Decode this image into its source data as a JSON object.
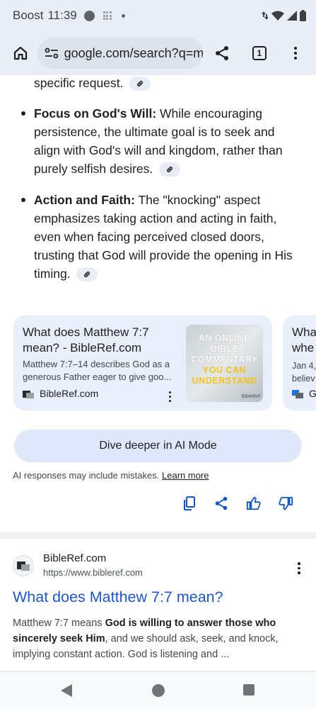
{
  "status_bar": {
    "carrier": "Boost",
    "time": "11:39",
    "icons": [
      "record-dot-icon",
      "grid-notification-icon",
      "dot-icon",
      "data-arrows-icon",
      "wifi-icon",
      "signal-icon",
      "battery-icon"
    ]
  },
  "browser": {
    "url": "google.com/search?q=m",
    "tab_count": "1",
    "icons": [
      "home-icon",
      "site-settings-icon",
      "share-icon",
      "tabs-icon",
      "more-vert-icon"
    ]
  },
  "ai_overview": {
    "lead_fragment": "specific request.",
    "bullets": [
      {
        "heading": "Focus on God's Will:",
        "text": " While encouraging persistence, the ultimate goal is to seek and align with God's will and kingdom, rather than purely selfish desires."
      },
      {
        "heading": "Action and Faith:",
        "text": " The \"knocking\" aspect emphasizes taking action and acting in faith, even when facing perceived closed doors, trusting that God will provide the opening in His timing."
      }
    ],
    "source_cards": [
      {
        "title": "What does Matthew 7:7 mean? - BibleRef.com",
        "snippet": "Matthew 7:7–14 describes God as a generous Father eager to give goo...",
        "source": "BibleRef.com",
        "thumb_line1": "AN ONLINE BIBLE COMMENTARY",
        "thumb_line2": "YOU CAN UNDERSTAND",
        "thumb_brand": "BibleRef"
      },
      {
        "title_partial": "Wha whe",
        "snippet_partial": "Jan 4, believ",
        "source_partial": "G"
      }
    ],
    "dive_button": "Dive deeper in AI Mode",
    "disclaimer": "AI responses may include mistakes.",
    "learn_more": "Learn more",
    "action_icons": [
      "copy-icon",
      "share-icon",
      "thumbs-up-icon",
      "thumbs-down-icon"
    ]
  },
  "result": {
    "site_name": "BibleRef.com",
    "site_url": "https://www.bibleref.com",
    "title": "What does Matthew 7:7 mean?",
    "snippet_pre": "Matthew 7:7 means ",
    "snippet_bold": "God is willing to answer those who sincerely seek Him",
    "snippet_post": ", and we should ask, seek, and knock, implying constant action. God is listening and ..."
  },
  "nav_bar": {
    "icons": [
      "back-icon",
      "home-circle-icon",
      "recents-icon"
    ]
  },
  "colors": {
    "chrome_bg": "#e9eef6",
    "card_bg": "#e8effb",
    "dive_bg": "#dfe8fb",
    "link_blue": "#1a56db",
    "accent_icon_blue": "#0b57d0"
  }
}
